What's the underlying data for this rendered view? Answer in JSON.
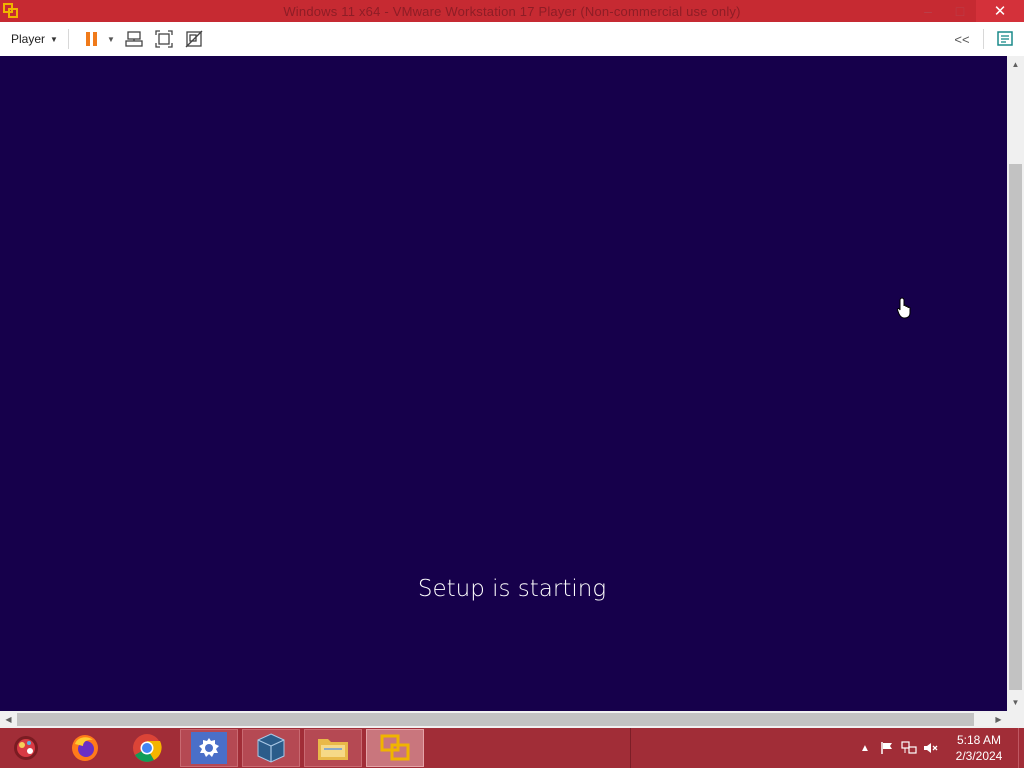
{
  "window": {
    "title": "Windows 11 x64 - VMware Workstation 17 Player (Non-commercial use only)",
    "minimize": "–",
    "maximize": "□",
    "close": "✕"
  },
  "toolbar": {
    "player_label": "Player",
    "icons": [
      "pause-icon",
      "send-ctrl-alt-del-icon",
      "fullscreen-icon",
      "unity-icon"
    ],
    "collapse_label": "<<",
    "right_icon": "library-icon"
  },
  "vm": {
    "status_text": "Setup is starting",
    "background": "#16004b"
  },
  "taskbar": {
    "apps": [
      "start-button",
      "firefox",
      "chrome",
      "settings",
      "virtualbox",
      "file-explorer",
      "vmware-player"
    ],
    "clock_time": "5:18 AM",
    "clock_date": "2/3/2024",
    "tray_icons": [
      "show-hidden-icons",
      "action-center-flag",
      "network",
      "volume-muted"
    ]
  },
  "colors": {
    "accent": "#c62a32",
    "taskbar": "#a12d37",
    "vm_bg": "#16004b"
  }
}
